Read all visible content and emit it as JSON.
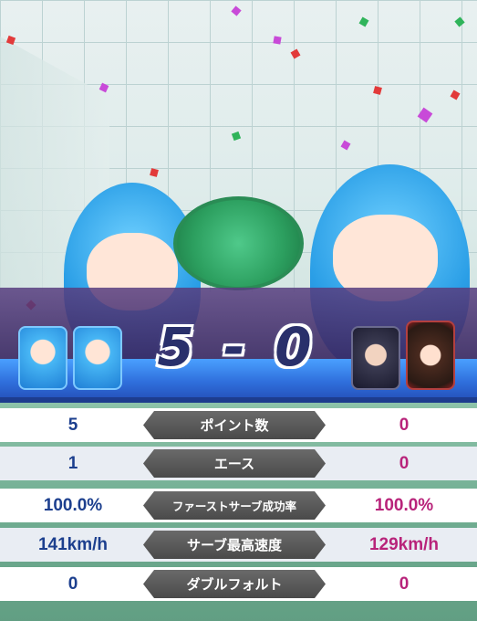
{
  "score": {
    "text": "5 - 0"
  },
  "players": {
    "left": [
      {
        "name": "blue-haired-character-1"
      },
      {
        "name": "blue-haired-character-2"
      }
    ],
    "right": [
      {
        "name": "white-haired-character"
      },
      {
        "name": "witch-hat-character"
      }
    ]
  },
  "stats": [
    {
      "label": "ポイント数",
      "left": "5",
      "right": "0"
    },
    {
      "label": "エース",
      "left": "1",
      "right": "0"
    },
    {
      "label": "ファーストサーブ成功率",
      "left": "100.0%",
      "right": "100.0%"
    },
    {
      "label": "サーブ最高速度",
      "left": "141km/h",
      "right": "129km/h"
    },
    {
      "label": "ダブルフォルト",
      "left": "0",
      "right": "0"
    }
  ],
  "colors": {
    "left_team": "#1c3f8e",
    "right_team": "#b8237a",
    "banner_blue": "#2f6fdc",
    "banner_purple": "#3a2862"
  }
}
